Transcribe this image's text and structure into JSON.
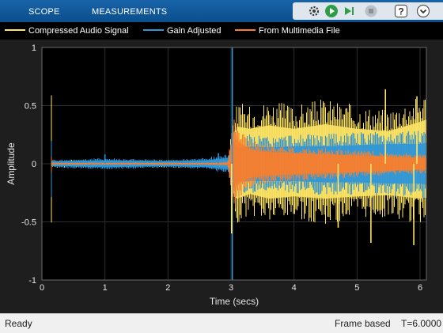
{
  "toolstrip": {
    "tabs": [
      {
        "label": "SCOPE"
      },
      {
        "label": "MEASUREMENTS"
      }
    ],
    "quick_access": [
      {
        "icon": "settings-gear-icon"
      },
      {
        "icon": "run-icon"
      },
      {
        "icon": "step-forward-icon"
      },
      {
        "icon": "stop-icon"
      },
      {
        "icon": "help-icon"
      },
      {
        "icon": "dock-down-icon"
      }
    ],
    "colors": {
      "background": "#0b5394",
      "run": "#2e9d46"
    }
  },
  "legend": {
    "items": [
      {
        "label": "Compressed Audio Signal",
        "color": "#ffe566"
      },
      {
        "label": "Gain Adjusted",
        "color": "#2f96d8"
      },
      {
        "label": "From Multimedia File",
        "color": "#f77f2f"
      }
    ]
  },
  "chart_data": {
    "type": "line",
    "xlabel": "Time (secs)",
    "ylabel": "Amplitude",
    "xlim": [
      0,
      6.1
    ],
    "ylim": [
      -1,
      1
    ],
    "xticks": [
      "0",
      "1",
      "2",
      "3",
      "4",
      "5",
      "6"
    ],
    "yticks": [
      "1",
      "0.5",
      "0",
      "-0.5",
      "-1"
    ],
    "grid": true,
    "background": "#000000",
    "series": [
      {
        "name": "Compressed Audio Signal",
        "color": "#ffe566",
        "x": [
          0.15,
          1.0,
          2.0,
          2.6,
          2.95,
          3.05,
          3.1,
          3.3,
          3.6,
          4.0,
          4.5,
          5.0,
          5.5,
          6.0,
          6.1
        ],
        "upper": [
          0.02,
          0.02,
          0.02,
          0.02,
          0.03,
          0.25,
          0.32,
          0.3,
          0.33,
          0.3,
          0.34,
          0.3,
          0.28,
          0.36,
          0.38
        ],
        "lower": [
          -0.02,
          -0.02,
          -0.02,
          -0.02,
          -0.03,
          -0.28,
          -0.3,
          -0.26,
          -0.3,
          -0.28,
          -0.3,
          -0.28,
          -0.27,
          -0.3,
          -0.29
        ]
      },
      {
        "name": "Gain Adjusted",
        "color": "#2f96d8",
        "x": [
          0.15,
          1.0,
          2.0,
          2.6,
          2.95,
          3.05,
          3.1,
          3.3,
          3.6,
          4.0,
          4.5,
          5.0,
          5.5,
          6.0,
          6.1
        ],
        "upper": [
          0.02,
          0.03,
          0.02,
          0.03,
          0.05,
          0.2,
          0.14,
          0.15,
          0.14,
          0.15,
          0.15,
          0.16,
          0.17,
          0.17,
          0.18
        ],
        "lower": [
          -0.02,
          -0.03,
          -0.02,
          -0.03,
          -0.05,
          -0.22,
          -0.16,
          -0.15,
          -0.15,
          -0.15,
          -0.16,
          -0.16,
          -0.17,
          -0.17,
          -0.18
        ]
      },
      {
        "name": "From Multimedia File",
        "color": "#f77f2f",
        "x": [
          0.15,
          1.0,
          2.0,
          2.6,
          2.95,
          3.05,
          3.1,
          3.3,
          3.6,
          4.0,
          4.5,
          5.0,
          5.5,
          6.0,
          6.1
        ],
        "upper": [
          0.005,
          0.005,
          0.005,
          0.005,
          0.01,
          0.3,
          0.2,
          0.12,
          0.1,
          0.09,
          0.08,
          0.07,
          0.06,
          0.05,
          0.05
        ],
        "lower": [
          -0.005,
          -0.005,
          -0.005,
          -0.005,
          -0.01,
          -0.25,
          -0.18,
          -0.12,
          -0.1,
          -0.09,
          -0.08,
          -0.07,
          -0.06,
          -0.05,
          -0.05
        ]
      }
    ],
    "spikes": [
      {
        "series": "Gain Adjusted",
        "x": 3.02,
        "y": 1.0
      },
      {
        "series": "Gain Adjusted",
        "x": 3.02,
        "y": -1.0
      },
      {
        "series": "Compressed Audio Signal",
        "x": 3.01,
        "y": -0.6
      },
      {
        "series": "Compressed Audio Signal",
        "x": 5.45,
        "y": 0.64
      },
      {
        "series": "Compressed Audio Signal",
        "x": 5.22,
        "y": -0.68
      },
      {
        "series": "Compressed Audio Signal",
        "x": 5.9,
        "y": -0.7
      },
      {
        "series": "Compressed Audio Signal",
        "x": 5.95,
        "y": 0.58
      },
      {
        "series": "Compressed Audio Signal",
        "x": 4.7,
        "y": -0.55
      },
      {
        "series": "Gain Adjusted",
        "x": 1.0,
        "y": 0.08
      },
      {
        "series": "Gain Adjusted",
        "x": 2.8,
        "y": 0.09
      }
    ]
  },
  "status": {
    "left": "Ready",
    "mode": "Frame based",
    "time": "T=6.0000"
  }
}
